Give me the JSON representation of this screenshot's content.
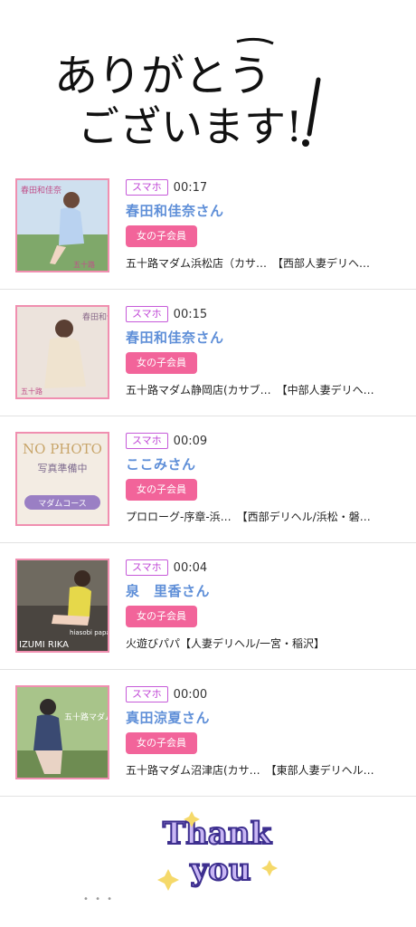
{
  "hero": {
    "line1": "ありがとう",
    "line2": "ございます!"
  },
  "entries": [
    {
      "device": "スマホ",
      "time": "00:17",
      "name": "春田和佳奈さん",
      "badge": "女の子会員",
      "shop": "五十路マダム浜松店（カサ…　【西部人妻デリヘ…"
    },
    {
      "device": "スマホ",
      "time": "00:15",
      "name": "春田和佳奈さん",
      "badge": "女の子会員",
      "shop": "五十路マダム静岡店(カサブ…　【中部人妻デリヘ…"
    },
    {
      "device": "スマホ",
      "time": "00:09",
      "name": "ここみさん",
      "badge": "女の子会員",
      "shop": "プロローグ-序章-浜…　【西部デリヘル/浜松・磐…"
    },
    {
      "device": "スマホ",
      "time": "00:04",
      "name": "泉　里香さん",
      "badge": "女の子会員",
      "shop": "火遊びパパ【人妻デリヘル/一宮・稲沢】"
    },
    {
      "device": "スマホ",
      "time": "00:00",
      "name": "真田涼夏さん",
      "badge": "女の子会員",
      "shop": "五十路マダム沼津店(カサ…　【東部人妻デリヘル…"
    }
  ],
  "thumbs": [
    {
      "overlay": "春田和佳奈",
      "logo": "五十路",
      "icon": "profile-photo"
    },
    {
      "overlay": "春田和佳奈",
      "logo": "五十路",
      "icon": "profile-photo"
    },
    {
      "overlay": "NO PHOTO",
      "sub": "写真準備中",
      "course": "マダムコース",
      "icon": "no-photo-placeholder"
    },
    {
      "overlay": "IZUMI RIKA",
      "logo": "hiasobi papa",
      "icon": "profile-photo"
    },
    {
      "overlay": "五十路マダム",
      "logo": "",
      "icon": "profile-photo"
    }
  ],
  "thanks": {
    "line1": "Thank",
    "line2": "you"
  },
  "footer": {
    "dots": "• • •"
  },
  "colors": {
    "accent_pink": "#f2649a",
    "name_blue": "#5f8fd8",
    "device_purple": "#c047d6"
  }
}
